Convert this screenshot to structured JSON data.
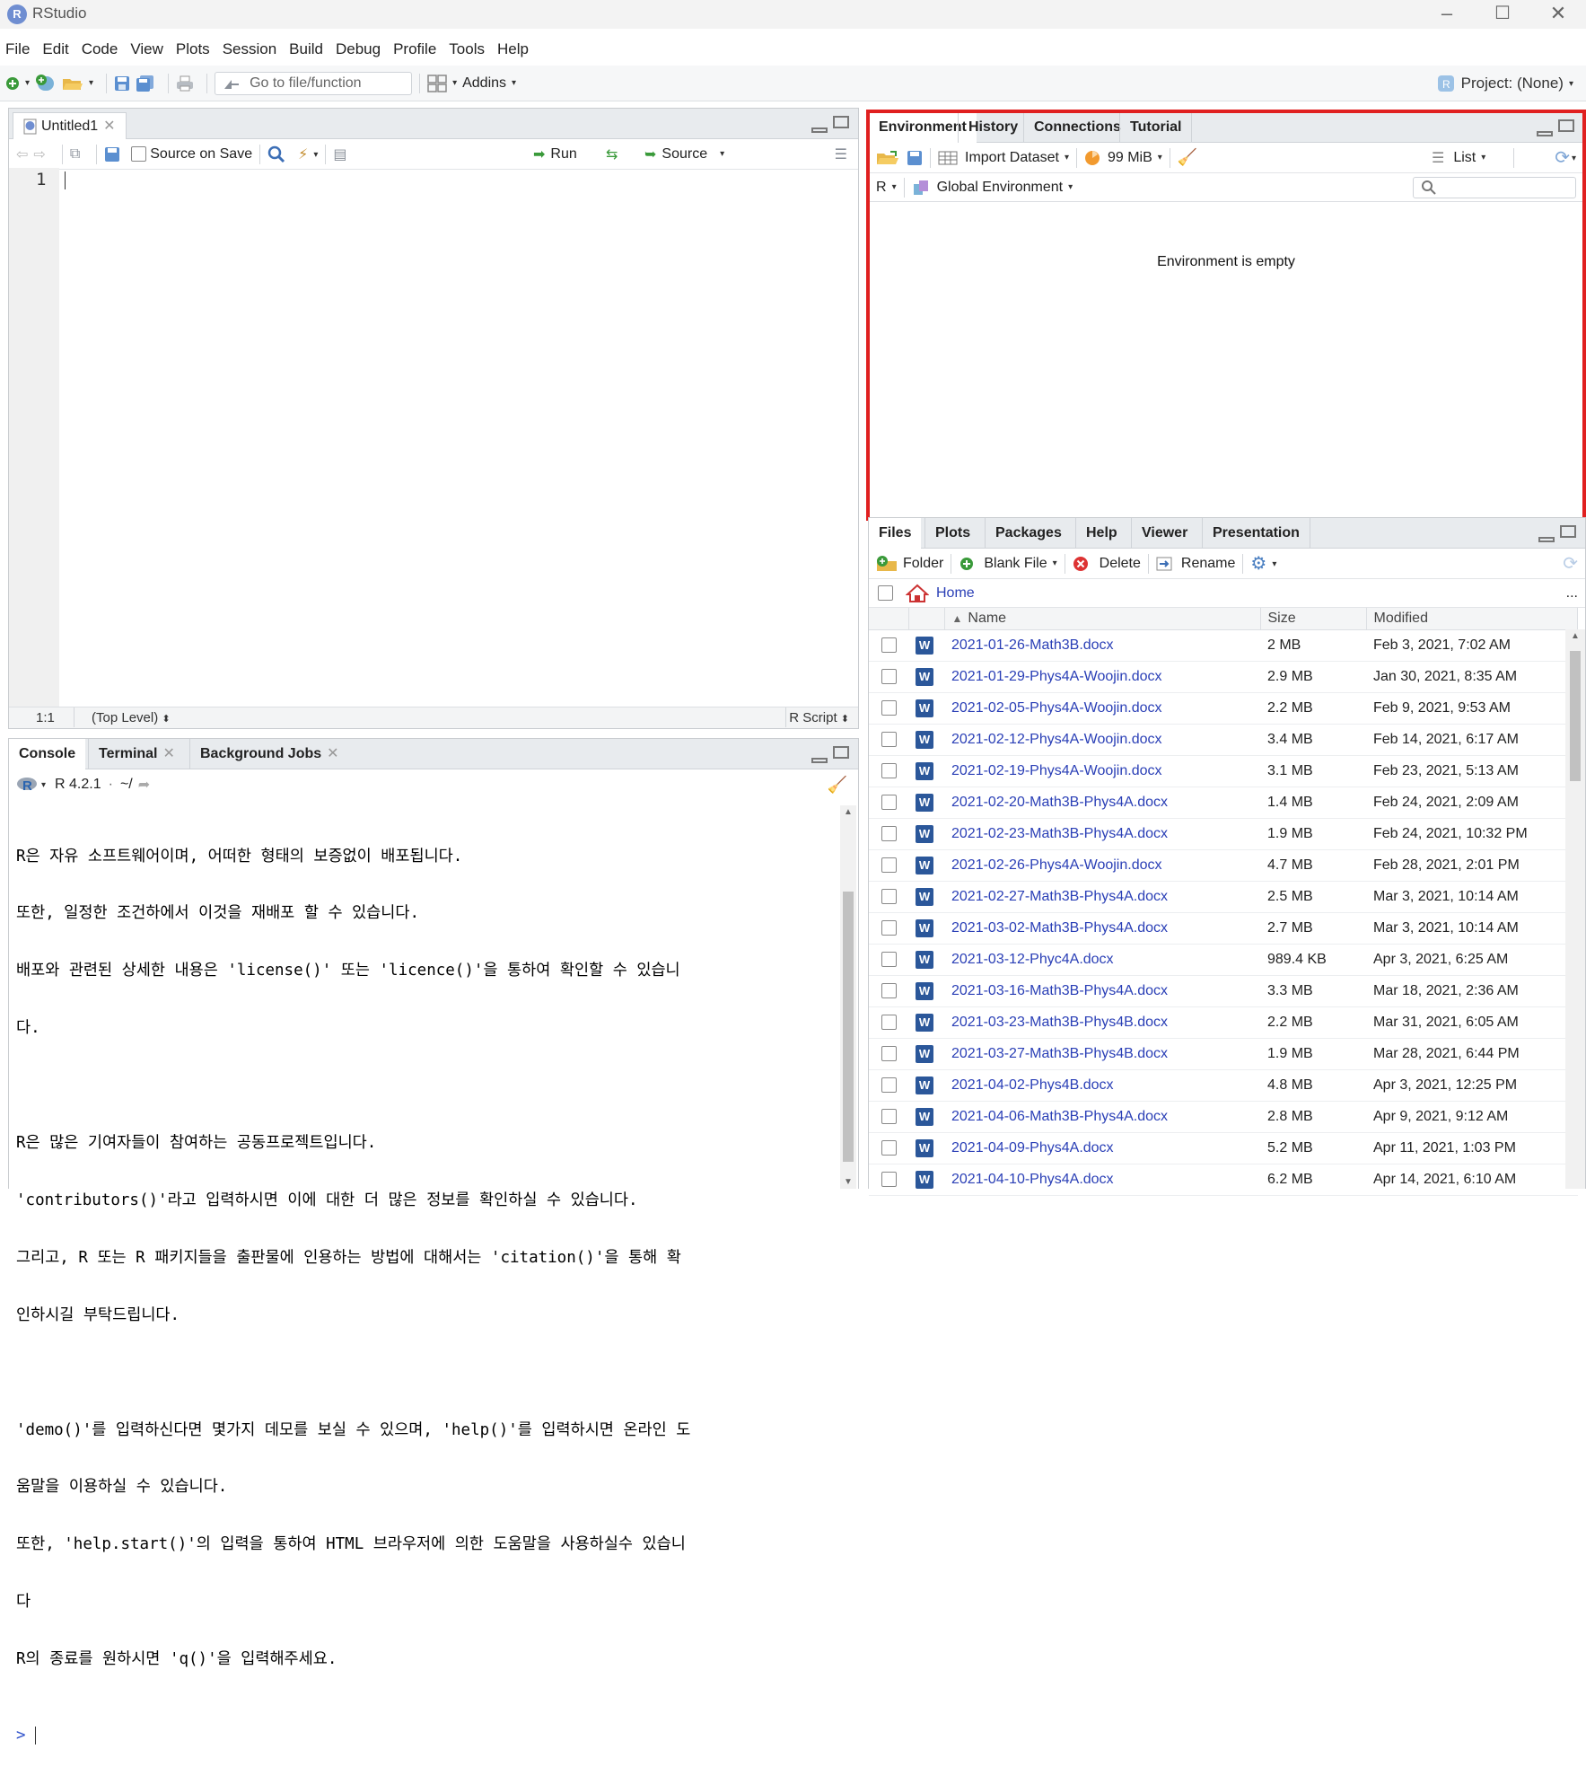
{
  "window": {
    "title": "RStudio",
    "logo_letter": "R"
  },
  "menu": [
    "File",
    "Edit",
    "Code",
    "View",
    "Plots",
    "Session",
    "Build",
    "Debug",
    "Profile",
    "Tools",
    "Help"
  ],
  "toolbar": {
    "goto_placeholder": "Go to file/function",
    "addins_label": "Addins",
    "project_label": "Project: (None)"
  },
  "editor": {
    "tab_label": "Untitled1",
    "source_on_save_label": "Source on Save",
    "run_label": "Run",
    "source_label": "Source",
    "line_number": "1",
    "status_position": "1:1",
    "status_scope": "(Top Level)",
    "status_type": "R Script"
  },
  "console": {
    "tabs": [
      "Console",
      "Terminal",
      "Background Jobs"
    ],
    "r_version": "R 4.2.1",
    "wd": "~/",
    "lines": [
      "R은 자유 소프트웨어이며, 어떠한 형태의 보증없이 배포됩니다.",
      "또한, 일정한 조건하에서 이것을 재배포 할 수 있습니다.",
      "배포와 관련된 상세한 내용은 'license()' 또는 'licence()'을 통하여 확인할 수 있습니",
      "다.",
      "",
      "R은 많은 기여자들이 참여하는 공동프로젝트입니다.",
      "'contributors()'라고 입력하시면 이에 대한 더 많은 정보를 확인하실 수 있습니다.",
      "그리고, R 또는 R 패키지들을 출판물에 인용하는 방법에 대해서는 'citation()'을 통해 확",
      "인하시길 부탁드립니다.",
      "",
      "'demo()'를 입력하신다면 몇가지 데모를 보실 수 있으며, 'help()'를 입력하시면 온라인 도",
      "움말을 이용하실 수 있습니다.",
      "또한, 'help.start()'의 입력을 통하여 HTML 브라우저에 의한 도움말을 사용하실수 있습니",
      "다",
      "R의 종료를 원하시면 'q()'을 입력해주세요."
    ],
    "prompt": ">"
  },
  "environment": {
    "tabs": [
      "Environment",
      "History",
      "Connections",
      "Tutorial"
    ],
    "import_label": "Import Dataset",
    "memory_label": "99 MiB",
    "list_label": "List",
    "lang_label": "R",
    "scope_label": "Global Environment",
    "empty_message": "Environment is empty"
  },
  "files": {
    "tabs": [
      "Files",
      "Plots",
      "Packages",
      "Help",
      "Viewer",
      "Presentation"
    ],
    "folder_label": "Folder",
    "blank_file_label": "Blank File",
    "delete_label": "Delete",
    "rename_label": "Rename",
    "breadcrumb": "Home",
    "more": "...",
    "columns": {
      "name": "Name",
      "size": "Size",
      "modified": "Modified"
    },
    "rows": [
      {
        "name": "2021-01-26-Math3B.docx",
        "size": "2 MB",
        "modified": "Feb 3, 2021, 7:02 AM"
      },
      {
        "name": "2021-01-29-Phys4A-Woojin.docx",
        "size": "2.9 MB",
        "modified": "Jan 30, 2021, 8:35 AM"
      },
      {
        "name": "2021-02-05-Phys4A-Woojin.docx",
        "size": "2.2 MB",
        "modified": "Feb 9, 2021, 9:53 AM"
      },
      {
        "name": "2021-02-12-Phys4A-Woojin.docx",
        "size": "3.4 MB",
        "modified": "Feb 14, 2021, 6:17 AM"
      },
      {
        "name": "2021-02-19-Phys4A-Woojin.docx",
        "size": "3.1 MB",
        "modified": "Feb 23, 2021, 5:13 AM"
      },
      {
        "name": "2021-02-20-Math3B-Phys4A.docx",
        "size": "1.4 MB",
        "modified": "Feb 24, 2021, 2:09 AM"
      },
      {
        "name": "2021-02-23-Math3B-Phys4A.docx",
        "size": "1.9 MB",
        "modified": "Feb 24, 2021, 10:32 PM"
      },
      {
        "name": "2021-02-26-Phys4A-Woojin.docx",
        "size": "4.7 MB",
        "modified": "Feb 28, 2021, 2:01 PM"
      },
      {
        "name": "2021-02-27-Math3B-Phys4A.docx",
        "size": "2.5 MB",
        "modified": "Mar 3, 2021, 10:14 AM"
      },
      {
        "name": "2021-03-02-Math3B-Phys4A.docx",
        "size": "2.7 MB",
        "modified": "Mar 3, 2021, 10:14 AM"
      },
      {
        "name": "2021-03-12-Phyc4A.docx",
        "size": "989.4 KB",
        "modified": "Apr 3, 2021, 6:25 AM"
      },
      {
        "name": "2021-03-16-Math3B-Phys4A.docx",
        "size": "3.3 MB",
        "modified": "Mar 18, 2021, 2:36 AM"
      },
      {
        "name": "2021-03-23-Math3B-Phys4B.docx",
        "size": "2.2 MB",
        "modified": "Mar 31, 2021, 6:05 AM"
      },
      {
        "name": "2021-03-27-Math3B-Phys4B.docx",
        "size": "1.9 MB",
        "modified": "Mar 28, 2021, 6:44 PM"
      },
      {
        "name": "2021-04-02-Phys4B.docx",
        "size": "4.8 MB",
        "modified": "Apr 3, 2021, 12:25 PM"
      },
      {
        "name": "2021-04-06-Math3B-Phys4A.docx",
        "size": "2.8 MB",
        "modified": "Apr 9, 2021, 9:12 AM"
      },
      {
        "name": "2021-04-09-Phys4A.docx",
        "size": "5.2 MB",
        "modified": "Apr 11, 2021, 1:03 PM"
      },
      {
        "name": "2021-04-10-Phys4A.docx",
        "size": "6.2 MB",
        "modified": "Apr 14, 2021, 6:10 AM"
      }
    ]
  },
  "colors": {
    "highlight": "#e02020",
    "link": "#2a3fb6",
    "word": "#2b579a"
  }
}
